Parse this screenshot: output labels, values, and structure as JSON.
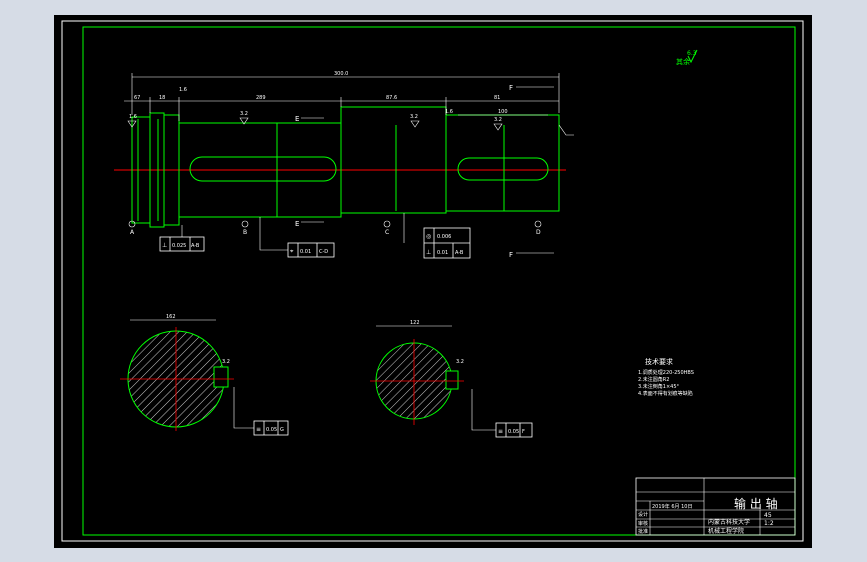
{
  "colors": {
    "background": "#000000",
    "frame": "#ffffff",
    "border": "#00ff00",
    "part": "#00ff00",
    "centerline": "#ff0000",
    "annotation": "#ffffff"
  },
  "dimensions": {
    "overall_length": "300.0",
    "seg_left_1": "67",
    "seg_left_2": "18",
    "seg_middle": "289",
    "seg_right_1": "87.6",
    "seg_right_2": "81",
    "keyway_right_len": "100",
    "section_left_dia": "162",
    "section_right_dia": "122"
  },
  "surface_finish": {
    "upper_right": "6.3",
    "s1": "1.6",
    "s2": "3.2",
    "s3": "3.2",
    "s4": "1.6",
    "s5": "3.2",
    "s6": "1.6",
    "s7": "3.2",
    "s8": "3.2"
  },
  "datum_labels": {
    "a": "A",
    "b": "B",
    "c": "C",
    "d": "D",
    "section_e": "E",
    "section_f": "F"
  },
  "tolerance_frames": {
    "frame1": {
      "sym": "⊥",
      "value": "0.025",
      "datum": "A-B"
    },
    "frame2": {
      "sym": "⌖",
      "value": "0.01",
      "datum": "C-D"
    },
    "frame3_top": {
      "sym": "◎",
      "value": "0.006"
    },
    "frame3_bottom": {
      "sym": "⊥",
      "value": "0.01",
      "datum": "A-B"
    },
    "frame4": {
      "sym": "≡",
      "value": "0.05",
      "datum": "G"
    },
    "frame5": {
      "sym": "≡",
      "value": "0.05",
      "datum": "F"
    }
  },
  "notes": {
    "title": "技术要求",
    "lines": [
      "1.调质处理220-250HBS",
      "2.未注圆角R2",
      "3.未注倒角1×45°",
      "4.表面不得有划痕等缺陷"
    ]
  },
  "title_block": {
    "part_name": "输 出 轴",
    "school": "内蒙古科技大学",
    "dept": "机械工程学院",
    "material": "45",
    "scale": "1:2",
    "rows": [
      "设计",
      "审核",
      "批准"
    ],
    "date": "2019年 6月 10日"
  }
}
